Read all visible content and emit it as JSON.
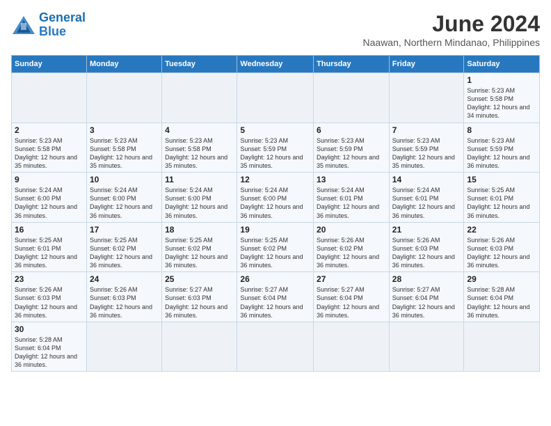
{
  "logo": {
    "text_general": "General",
    "text_blue": "Blue"
  },
  "title": "June 2024",
  "subtitle": "Naawan, Northern Mindanao, Philippines",
  "days_of_week": [
    "Sunday",
    "Monday",
    "Tuesday",
    "Wednesday",
    "Thursday",
    "Friday",
    "Saturday"
  ],
  "weeks": [
    [
      {
        "day": "",
        "info": ""
      },
      {
        "day": "",
        "info": ""
      },
      {
        "day": "",
        "info": ""
      },
      {
        "day": "",
        "info": ""
      },
      {
        "day": "",
        "info": ""
      },
      {
        "day": "",
        "info": ""
      },
      {
        "day": "1",
        "info": "Sunrise: 5:23 AM\nSunset: 5:58 PM\nDaylight: 12 hours and 34 minutes."
      }
    ],
    [
      {
        "day": "2",
        "info": "Sunrise: 5:23 AM\nSunset: 5:58 PM\nDaylight: 12 hours and 35 minutes."
      },
      {
        "day": "3",
        "info": "Sunrise: 5:23 AM\nSunset: 5:58 PM\nDaylight: 12 hours and 35 minutes."
      },
      {
        "day": "4",
        "info": "Sunrise: 5:23 AM\nSunset: 5:58 PM\nDaylight: 12 hours and 35 minutes."
      },
      {
        "day": "5",
        "info": "Sunrise: 5:23 AM\nSunset: 5:59 PM\nDaylight: 12 hours and 35 minutes."
      },
      {
        "day": "6",
        "info": "Sunrise: 5:23 AM\nSunset: 5:59 PM\nDaylight: 12 hours and 35 minutes."
      },
      {
        "day": "7",
        "info": "Sunrise: 5:23 AM\nSunset: 5:59 PM\nDaylight: 12 hours and 35 minutes."
      },
      {
        "day": "8",
        "info": "Sunrise: 5:23 AM\nSunset: 5:59 PM\nDaylight: 12 hours and 36 minutes."
      }
    ],
    [
      {
        "day": "9",
        "info": "Sunrise: 5:24 AM\nSunset: 6:00 PM\nDaylight: 12 hours and 36 minutes."
      },
      {
        "day": "10",
        "info": "Sunrise: 5:24 AM\nSunset: 6:00 PM\nDaylight: 12 hours and 36 minutes."
      },
      {
        "day": "11",
        "info": "Sunrise: 5:24 AM\nSunset: 6:00 PM\nDaylight: 12 hours and 36 minutes."
      },
      {
        "day": "12",
        "info": "Sunrise: 5:24 AM\nSunset: 6:00 PM\nDaylight: 12 hours and 36 minutes."
      },
      {
        "day": "13",
        "info": "Sunrise: 5:24 AM\nSunset: 6:01 PM\nDaylight: 12 hours and 36 minutes."
      },
      {
        "day": "14",
        "info": "Sunrise: 5:24 AM\nSunset: 6:01 PM\nDaylight: 12 hours and 36 minutes."
      },
      {
        "day": "15",
        "info": "Sunrise: 5:25 AM\nSunset: 6:01 PM\nDaylight: 12 hours and 36 minutes."
      }
    ],
    [
      {
        "day": "16",
        "info": "Sunrise: 5:25 AM\nSunset: 6:01 PM\nDaylight: 12 hours and 36 minutes."
      },
      {
        "day": "17",
        "info": "Sunrise: 5:25 AM\nSunset: 6:02 PM\nDaylight: 12 hours and 36 minutes."
      },
      {
        "day": "18",
        "info": "Sunrise: 5:25 AM\nSunset: 6:02 PM\nDaylight: 12 hours and 36 minutes."
      },
      {
        "day": "19",
        "info": "Sunrise: 5:25 AM\nSunset: 6:02 PM\nDaylight: 12 hours and 36 minutes."
      },
      {
        "day": "20",
        "info": "Sunrise: 5:26 AM\nSunset: 6:02 PM\nDaylight: 12 hours and 36 minutes."
      },
      {
        "day": "21",
        "info": "Sunrise: 5:26 AM\nSunset: 6:03 PM\nDaylight: 12 hours and 36 minutes."
      },
      {
        "day": "22",
        "info": "Sunrise: 5:26 AM\nSunset: 6:03 PM\nDaylight: 12 hours and 36 minutes."
      }
    ],
    [
      {
        "day": "23",
        "info": "Sunrise: 5:26 AM\nSunset: 6:03 PM\nDaylight: 12 hours and 36 minutes."
      },
      {
        "day": "24",
        "info": "Sunrise: 5:26 AM\nSunset: 6:03 PM\nDaylight: 12 hours and 36 minutes."
      },
      {
        "day": "25",
        "info": "Sunrise: 5:27 AM\nSunset: 6:03 PM\nDaylight: 12 hours and 36 minutes."
      },
      {
        "day": "26",
        "info": "Sunrise: 5:27 AM\nSunset: 6:04 PM\nDaylight: 12 hours and 36 minutes."
      },
      {
        "day": "27",
        "info": "Sunrise: 5:27 AM\nSunset: 6:04 PM\nDaylight: 12 hours and 36 minutes."
      },
      {
        "day": "28",
        "info": "Sunrise: 5:27 AM\nSunset: 6:04 PM\nDaylight: 12 hours and 36 minutes."
      },
      {
        "day": "29",
        "info": "Sunrise: 5:28 AM\nSunset: 6:04 PM\nDaylight: 12 hours and 36 minutes."
      }
    ],
    [
      {
        "day": "30",
        "info": "Sunrise: 5:28 AM\nSunset: 6:04 PM\nDaylight: 12 hours and 36 minutes."
      },
      {
        "day": "",
        "info": ""
      },
      {
        "day": "",
        "info": ""
      },
      {
        "day": "",
        "info": ""
      },
      {
        "day": "",
        "info": ""
      },
      {
        "day": "",
        "info": ""
      },
      {
        "day": "",
        "info": ""
      }
    ]
  ]
}
